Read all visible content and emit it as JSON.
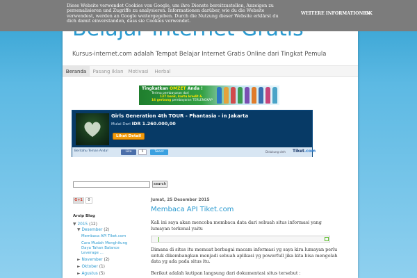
{
  "blog": {
    "title": "Belajar Internet Gratis",
    "description": "Kursus-internet.com adalah Tempat Belajar Internet Gratis Online dari Tingkat Pemula"
  },
  "tabs": [
    {
      "label": "Beranda",
      "active": true
    },
    {
      "label": "Pasang Iklan",
      "active": false
    },
    {
      "label": "Motivasi",
      "active": false
    },
    {
      "label": "Herbal",
      "active": false
    }
  ],
  "cookie": {
    "message": "Diese Website verwendet Cookies von Google, um ihre Dienste bereitzustellen, Anzeigen zu personalisieren und Zugriffe zu analysieren. Informationen darüber, wie du die Website verwendest, werden an Google weitergegeben. Durch die Nutzung dieser Website erklärst du dich damit einverstanden, dass sie Cookies verwendet.",
    "more_info": "WEITERE INFORMATIONEN",
    "ok": "OK"
  },
  "banner": {
    "headline_prefix": "Tingkatkan",
    "headline_highlight": "OMZET",
    "headline_suffix": "Anda !",
    "line1": "Terima pembayaran dari",
    "line2_highlight": "137 bank, kartu kredit &",
    "line3_highlight": "16 gerbang",
    "line3_suffix": "pembayaran TERLENGKAP"
  },
  "ticket": {
    "title": "Girls Generation 4th TOUR - Phantasia - in Jakarta",
    "price_label": "Mulai Dari",
    "price": "IDR 1.260.000,00",
    "detail_button": "Lihat Detail",
    "share_label": "Beritahu Teman Anda!",
    "fb_like": "Like",
    "fb_count": "5",
    "tweet": "Tweet",
    "powered_by": "Didukung oleh",
    "logo_main": "Tiket",
    "logo_suffix": ".com"
  },
  "search": {
    "button": "search",
    "value": ""
  },
  "sidebar": {
    "gplus_label": "G+1",
    "gplus_count": "0",
    "archive_title": "Arsip Blog",
    "archive": {
      "y2015": {
        "label": "2015",
        "count": "(12)"
      },
      "desember": {
        "label": "Desember",
        "count": "(2)"
      },
      "posts": [
        "Membaca API Tiket.com",
        "Cara Mudah Menghitung Daya Tahan Balance Leverage ..."
      ],
      "november": {
        "label": "November",
        "count": "(2)"
      },
      "oktober": {
        "label": "Oktober",
        "count": "(1)"
      },
      "agustus": {
        "label": "Agustus",
        "count": "(5)"
      }
    }
  },
  "post": {
    "date": "Jumat, 25 Desember 2015",
    "title": "Membaca API Tiket.com",
    "para1": "Kali ini saya akan mencoba membaca data dari sebuah situs informasi yang lumayan terkenal yaitu",
    "para2": "Dimana di situs itu memuat berbagai macam informasi yg saya kira lumayan perlu untuk dikembangkan menjadi sebuah aplikasi yg powerfull jika kita bisa mengolah data yg ada pada situs itu.",
    "para3": "Berikut adalah kutipan langsung dari dokumentasi situs tersebut :"
  },
  "colors": {
    "accent": "#2a9ad0",
    "cookie_bar": "#7c7c7c",
    "widget_bg": "#073a66",
    "detail_button": "#f29a0a"
  }
}
